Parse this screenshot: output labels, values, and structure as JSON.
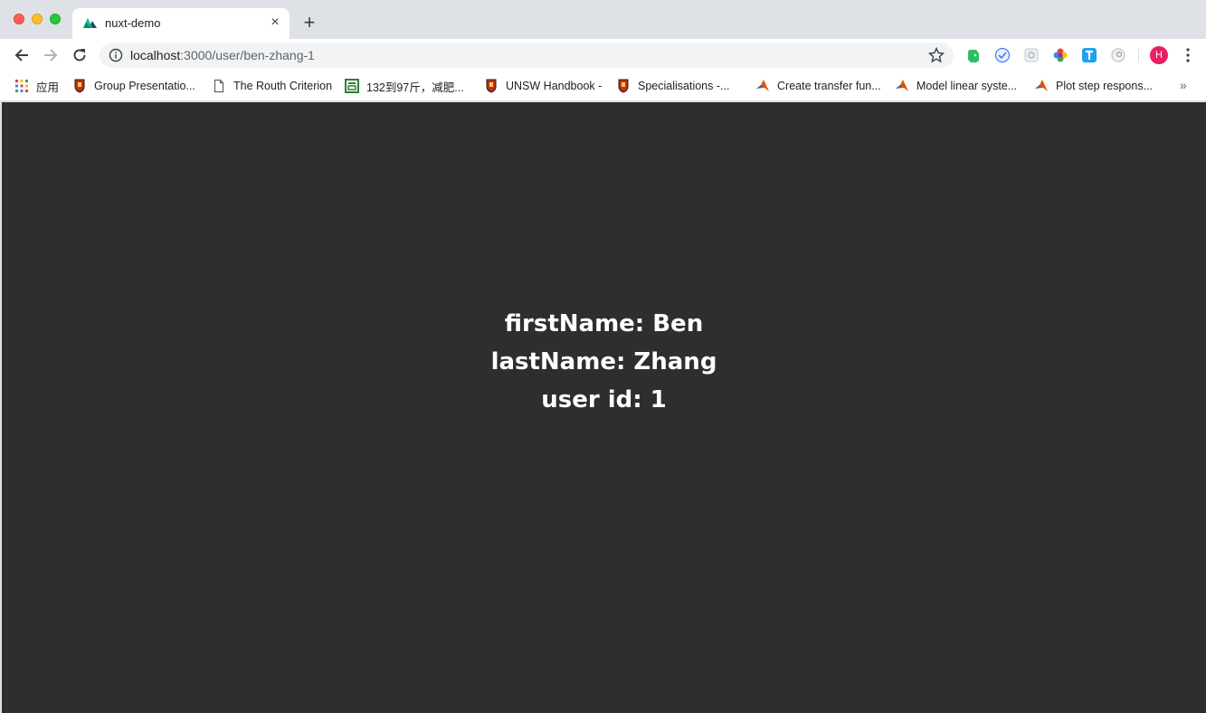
{
  "tab": {
    "title": "nuxt-demo",
    "close": "×"
  },
  "newtab": "+",
  "address": {
    "host": "localhost",
    "path": ":3000/user/ben-zhang-1"
  },
  "bookmarks": [
    {
      "label": "应用",
      "icon": "apps-grid-icon"
    },
    {
      "label": "Group Presentatio...",
      "icon": "unsw-crest-icon"
    },
    {
      "label": "The Routh Criterion",
      "icon": "document-icon"
    },
    {
      "label": "132到97斤，减肥...",
      "icon": "green-site-icon"
    },
    {
      "label": "UNSW Handbook -",
      "icon": "unsw-crest-icon"
    },
    {
      "label": "Specialisations -...",
      "icon": "unsw-crest-icon"
    },
    {
      "label": "Create transfer fun...",
      "icon": "matlab-icon"
    },
    {
      "label": "Model linear syste...",
      "icon": "matlab-icon"
    },
    {
      "label": "Plot step respons...",
      "icon": "matlab-icon"
    }
  ],
  "bookmarks_more": "»",
  "profile": {
    "initial": "H",
    "color": "#e91e63"
  },
  "page": {
    "firstName_line": "firstName: Ben",
    "lastName_line": "lastName: Zhang",
    "userid_line": "user id: 1"
  },
  "colors": {
    "page_bg": "#2e2e2e",
    "text": "#ffffff",
    "nuxt": "#00c58e"
  }
}
